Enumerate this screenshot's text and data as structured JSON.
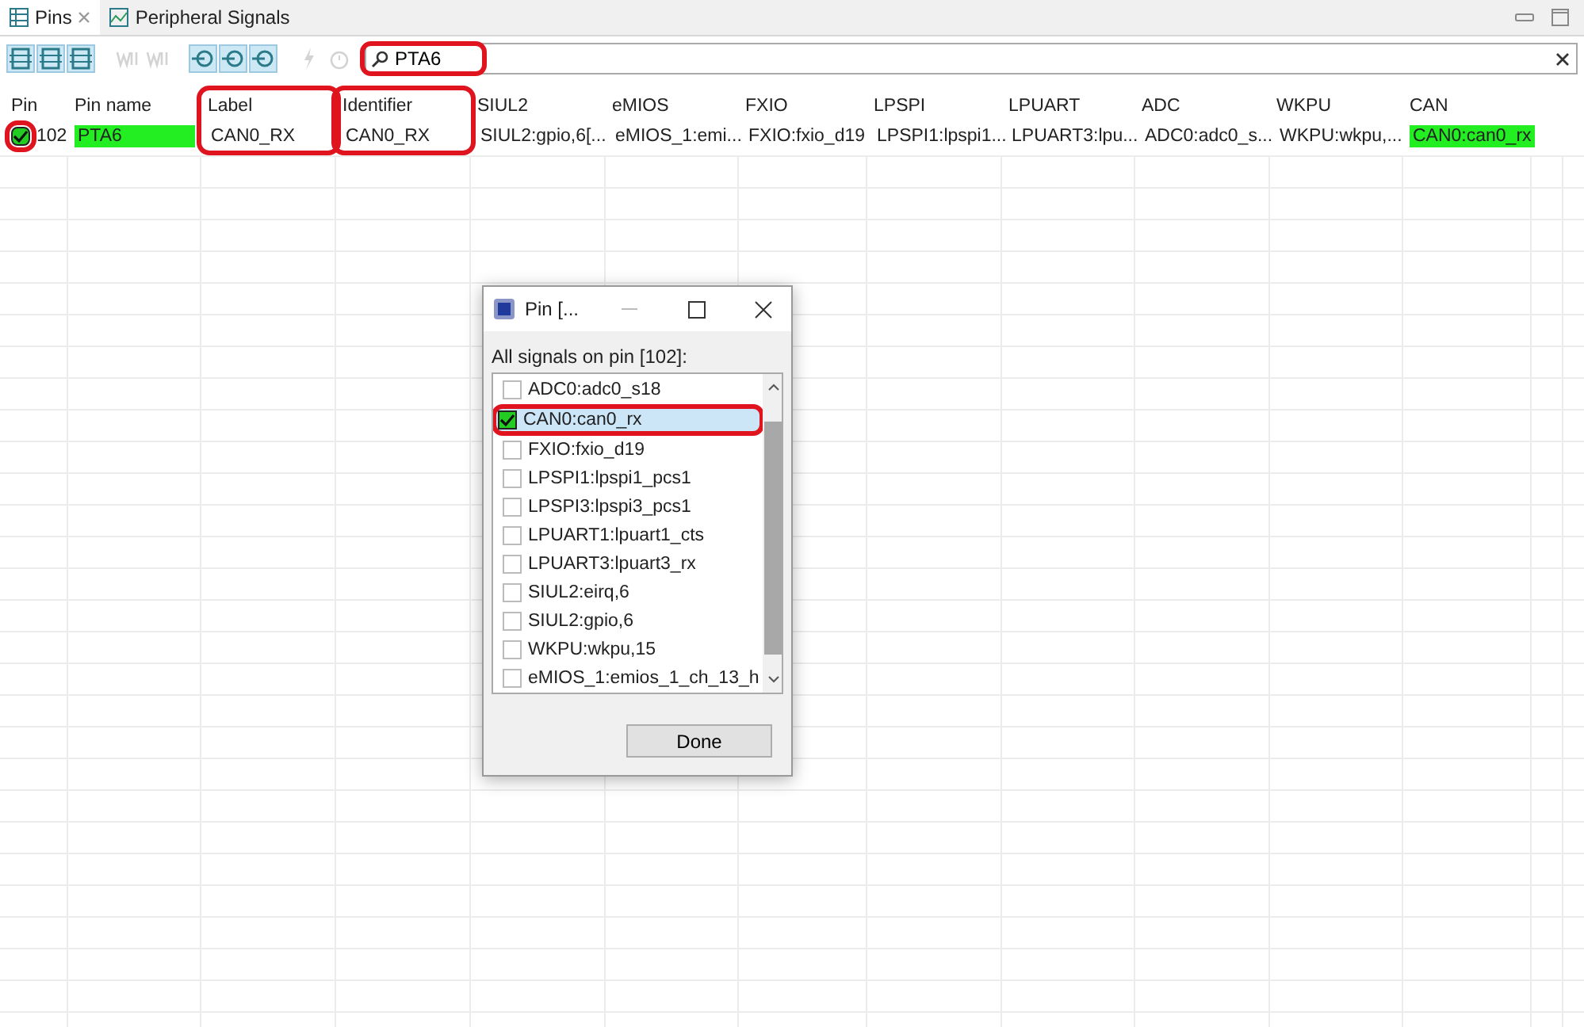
{
  "tabs": [
    {
      "label": "Pins",
      "selected": true,
      "closable": true
    },
    {
      "label": "Peripheral Signals",
      "selected": false,
      "closable": false
    }
  ],
  "toolbar": {
    "buttons": [
      {
        "pressed": true,
        "disabled": false
      },
      {
        "pressed": true,
        "disabled": false
      },
      {
        "pressed": true,
        "disabled": false
      },
      {
        "pressed": false,
        "disabled": true
      },
      {
        "pressed": false,
        "disabled": true
      },
      {
        "pressed": true,
        "disabled": false
      },
      {
        "pressed": true,
        "disabled": false
      },
      {
        "pressed": true,
        "disabled": false
      },
      {
        "pressed": false,
        "disabled": true
      },
      {
        "pressed": false,
        "disabled": true
      }
    ],
    "search": {
      "value": "PTA6",
      "highlighted": true
    }
  },
  "table": {
    "columns": [
      {
        "label": "Pin",
        "highlighted": false
      },
      {
        "label": "Pin name",
        "highlighted": false
      },
      {
        "label": "Label",
        "highlighted": true
      },
      {
        "label": "Identifier",
        "highlighted": true
      },
      {
        "label": "SIUL2",
        "highlighted": false
      },
      {
        "label": "eMIOS",
        "highlighted": false
      },
      {
        "label": "FXIO",
        "highlighted": false
      },
      {
        "label": "LPSPI",
        "highlighted": false
      },
      {
        "label": "LPUART",
        "highlighted": false
      },
      {
        "label": "ADC",
        "highlighted": false
      },
      {
        "label": "WKPU",
        "highlighted": false
      },
      {
        "label": "CAN",
        "highlighted": false
      }
    ],
    "rows": [
      {
        "checked": true,
        "check_highlighted": true,
        "cells": [
          {
            "text": "102",
            "assigned": false
          },
          {
            "text": "PTA6",
            "assigned": true
          },
          {
            "text": "CAN0_RX",
            "assigned": false
          },
          {
            "text": "CAN0_RX",
            "assigned": false
          },
          {
            "text": "SIUL2:gpio,6[...",
            "assigned": false
          },
          {
            "text": "eMIOS_1:emi...",
            "assigned": false
          },
          {
            "text": "FXIO:fxio_d19",
            "assigned": false
          },
          {
            "text": "LPSPI1:lpspi1...",
            "assigned": false
          },
          {
            "text": "LPUART3:lpu...",
            "assigned": false
          },
          {
            "text": "ADC0:adc0_s...",
            "assigned": false
          },
          {
            "text": "WKPU:wkpu,...",
            "assigned": false
          },
          {
            "text": "CAN0:can0_rx",
            "assigned": true
          }
        ]
      }
    ]
  },
  "dialog": {
    "title": "Pin [...",
    "prompt": "All signals on pin [102]:",
    "items": [
      {
        "label": "ADC0:adc0_s18",
        "checked": false,
        "selected": false,
        "highlighted": false
      },
      {
        "label": "CAN0:can0_rx",
        "checked": true,
        "selected": true,
        "highlighted": true
      },
      {
        "label": "FXIO:fxio_d19",
        "checked": false,
        "selected": false,
        "highlighted": false
      },
      {
        "label": "LPSPI1:lpspi1_pcs1",
        "checked": false,
        "selected": false,
        "highlighted": false
      },
      {
        "label": "LPSPI3:lpspi3_pcs1",
        "checked": false,
        "selected": false,
        "highlighted": false
      },
      {
        "label": "LPUART1:lpuart1_cts",
        "checked": false,
        "selected": false,
        "highlighted": false
      },
      {
        "label": "LPUART3:lpuart3_rx",
        "checked": false,
        "selected": false,
        "highlighted": false
      },
      {
        "label": "SIUL2:eirq,6",
        "checked": false,
        "selected": false,
        "highlighted": false
      },
      {
        "label": "SIUL2:gpio,6",
        "checked": false,
        "selected": false,
        "highlighted": false
      },
      {
        "label": "WKPU:wkpu,15",
        "checked": false,
        "selected": false,
        "highlighted": false
      },
      {
        "label": "eMIOS_1:emios_1_ch_13_h",
        "checked": false,
        "selected": false,
        "highlighted": false
      }
    ],
    "button": "Done"
  }
}
